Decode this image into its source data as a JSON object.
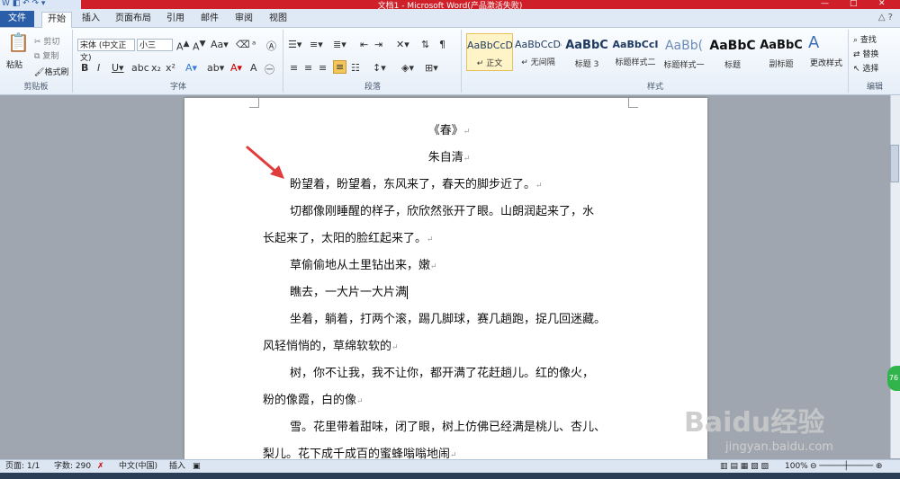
{
  "window": {
    "title": "文档1 - Microsoft Word(产品激活失败)"
  },
  "tabs": [
    {
      "label": "文件"
    },
    {
      "label": "开始"
    },
    {
      "label": "插入"
    },
    {
      "label": "页面布局"
    },
    {
      "label": "引用"
    },
    {
      "label": "邮件"
    },
    {
      "label": "审阅"
    },
    {
      "label": "视图"
    }
  ],
  "ribbon": {
    "clipboard": {
      "paste": "粘贴",
      "cut": "剪切",
      "copy": "复制",
      "format_painter": "格式刷",
      "group": "剪贴板"
    },
    "font": {
      "name": "宋体 (中文正文)",
      "size": "小三",
      "group": "字体"
    },
    "paragraph": {
      "group": "段落"
    },
    "styles": {
      "items": [
        {
          "preview": "AaBbCcDd",
          "name": "↵ 正文"
        },
        {
          "preview": "AaBbCcDd",
          "name": "↵ 无间隔"
        },
        {
          "preview": "AaBbC",
          "name": "标题 3"
        },
        {
          "preview": "AaBbCcI",
          "name": "标题样式二"
        },
        {
          "preview": "AaBb(",
          "name": "标题样式一"
        },
        {
          "preview": "AaBbC",
          "name": "标题"
        },
        {
          "preview": "AaBbC",
          "name": "副标题"
        }
      ],
      "change": "更改样式",
      "group": "样式"
    },
    "editing": {
      "find": "查找",
      "replace": "替换",
      "select": "选择",
      "group": "编辑"
    }
  },
  "document": {
    "title": "《春》",
    "author": "朱自清",
    "lines": [
      "盼望着，盼望着，东风来了，春天的脚步近了。",
      "切都像刚睡醒的样子，欣欣然张开了眼。山朗润起来了，水",
      "长起来了，太阳的脸红起来了。",
      "草偷偷地从土里钻出来，嫩",
      "瞧去，一大片一大片满",
      "坐着，躺着，打两个滚，踢几脚球，赛几趟跑，捉几回迷藏。",
      "风轻悄悄的，草绵软软的",
      "树，你不让我，我不让你，都开满了花赶趟儿。红的像火，",
      "粉的像霞，白的像",
      "雪。花里带着甜味，闭了眼，树上仿佛已经满是桃儿、杏儿、",
      "梨儿。花下成千成百的蜜蜂嗡嗡地闹"
    ]
  },
  "status": {
    "page": "页面: 1/1",
    "words": "字数: 290",
    "lang": "中文(中国)",
    "mode": "插入",
    "zoom": "100%"
  },
  "watermark": {
    "logo": "Baidu经验",
    "url": "jingyan.baidu.com"
  },
  "side_badge": "76"
}
